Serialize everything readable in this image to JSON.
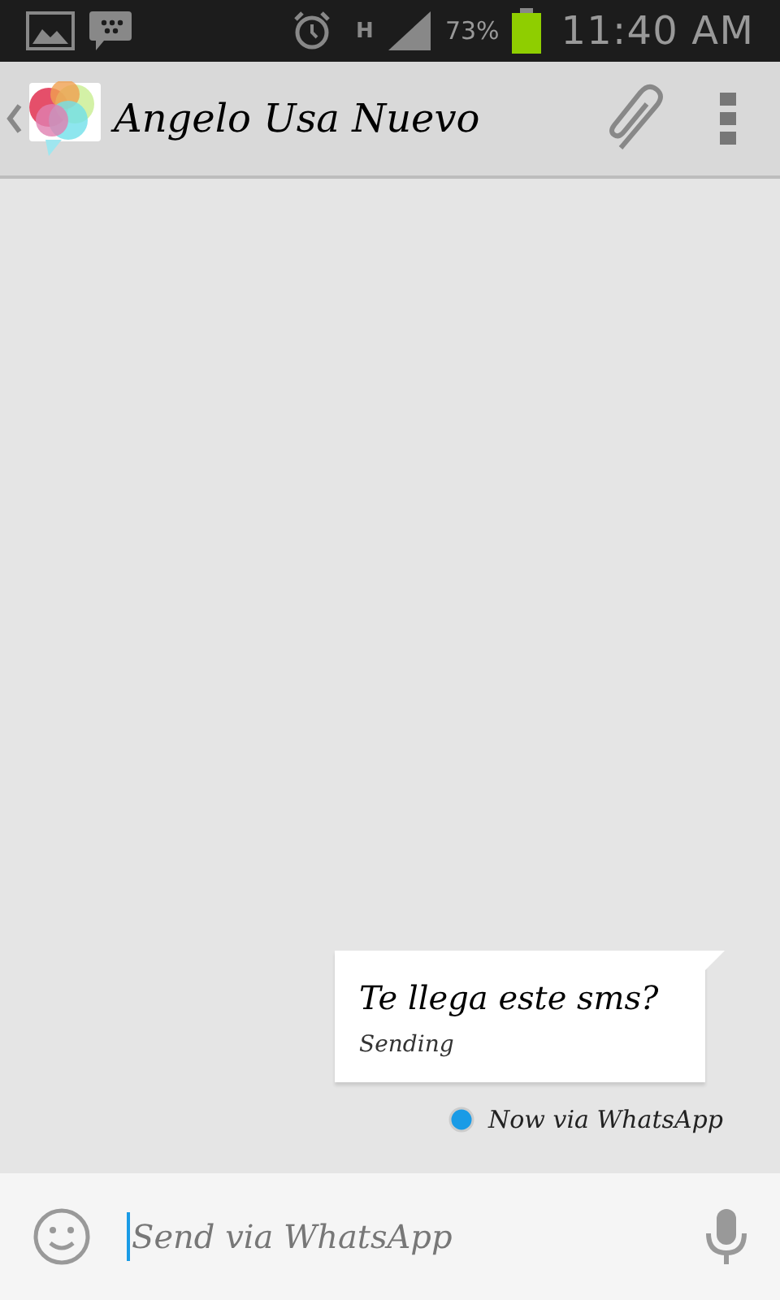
{
  "status_bar": {
    "network": "H",
    "battery_percent": "73%",
    "time": "11:40 AM"
  },
  "header": {
    "title": "Angelo Usa Nuevo"
  },
  "messages": [
    {
      "text": "Te llega este sms?",
      "status": "Sending"
    }
  ],
  "delivery_note": "Now via WhatsApp",
  "composer": {
    "placeholder": "Send via WhatsApp"
  }
}
